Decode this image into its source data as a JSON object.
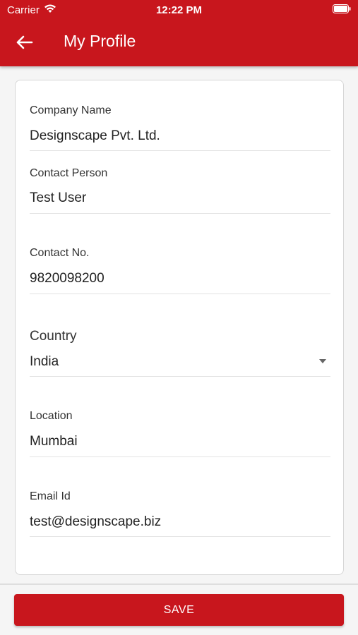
{
  "status_bar": {
    "carrier": "Carrier",
    "time": "12:22 PM"
  },
  "header": {
    "title": "My Profile",
    "back_icon": "arrow-left-icon"
  },
  "fields": [
    {
      "label": "Company Name",
      "value": "Designscape Pvt. Ltd."
    },
    {
      "label": "Contact Person",
      "value": "Test User"
    },
    {
      "label": "Contact No.",
      "value": "9820098200"
    },
    {
      "label": "Country",
      "value": "India"
    },
    {
      "label": "Location",
      "value": "Mumbai"
    },
    {
      "label": "Email Id",
      "value": "test@designscape.biz"
    }
  ],
  "footer": {
    "save_label": "SAVE"
  },
  "colors": {
    "brand": "#c8161d"
  }
}
